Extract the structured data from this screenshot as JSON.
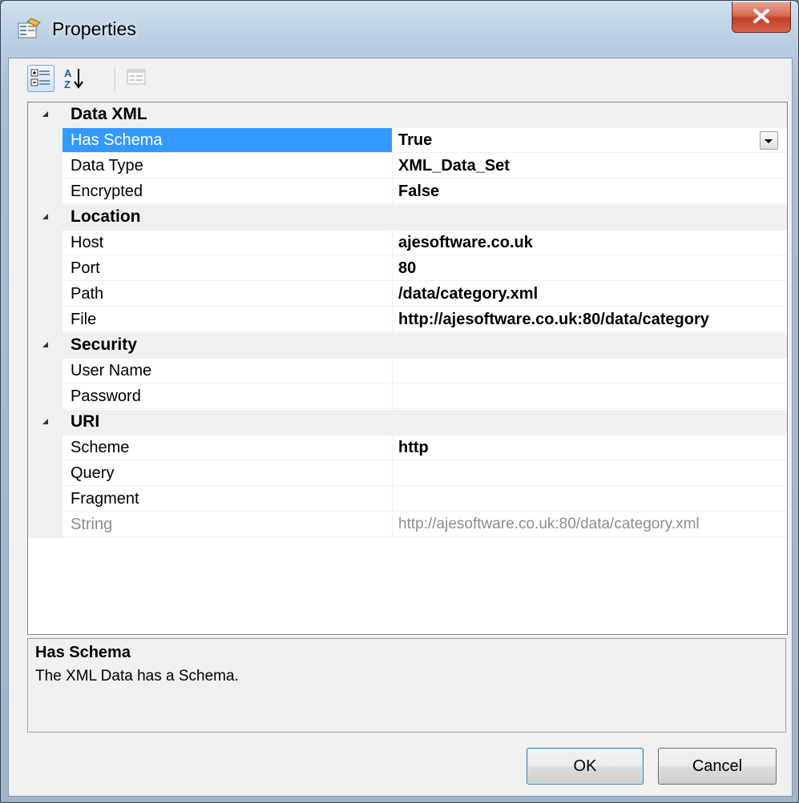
{
  "window": {
    "title": "Properties"
  },
  "toolbar": {
    "categorized": "categorized-view",
    "alphabetical": "alphabetical-sort",
    "property_pages": "property-pages"
  },
  "grid": {
    "categories": [
      {
        "label": "Data XML",
        "properties": [
          {
            "name": "Has Schema",
            "value": "True",
            "selected": true,
            "dropdown": true
          },
          {
            "name": "Data Type",
            "value": "XML_Data_Set"
          },
          {
            "name": "Encrypted",
            "value": "False"
          }
        ]
      },
      {
        "label": "Location",
        "properties": [
          {
            "name": "Host",
            "value": "ajesoftware.co.uk"
          },
          {
            "name": "Port",
            "value": "80"
          },
          {
            "name": "Path",
            "value": "/data/category.xml"
          },
          {
            "name": "File",
            "value": "http://ajesoftware.co.uk:80/data/category"
          }
        ]
      },
      {
        "label": "Security",
        "properties": [
          {
            "name": "User Name",
            "value": ""
          },
          {
            "name": "Password",
            "value": ""
          }
        ]
      },
      {
        "label": "URI",
        "properties": [
          {
            "name": "Scheme",
            "value": "http"
          },
          {
            "name": "Query",
            "value": ""
          },
          {
            "name": "Fragment",
            "value": ""
          },
          {
            "name": "String",
            "value": "http://ajesoftware.co.uk:80/data/category.xml",
            "readonly": true
          }
        ]
      }
    ]
  },
  "help": {
    "title": "Has Schema",
    "description": "The XML Data has a Schema."
  },
  "buttons": {
    "ok": "OK",
    "cancel": "Cancel"
  }
}
